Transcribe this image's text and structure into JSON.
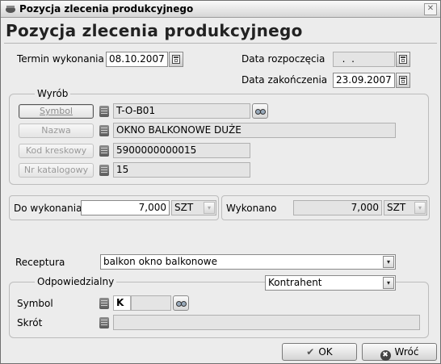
{
  "window": {
    "title": "Pozycja zlecenia produkcyjnego",
    "close_glyph": "✕"
  },
  "header": {
    "title": "Pozycja zlecenia produkcyjnego"
  },
  "dates": {
    "termin_label": "Termin wykonania",
    "termin_value": "08.10.2007",
    "rozpoczecie_label": "Data rozpoczęcia",
    "rozpoczecie_value": "  .  .",
    "zakonczenie_label": "Data zakończenia",
    "zakonczenie_value": "23.09.2007"
  },
  "wyrob": {
    "group_label": "Wyrób",
    "symbol_label": "Symbol",
    "symbol_value": "T-O-B01",
    "nazwa_label": "Nazwa",
    "nazwa_value": "OKNO BALKONOWE DUŻE",
    "kod_label": "Kod kreskowy",
    "kod_value": "5900000000015",
    "nr_label": "Nr katalogowy",
    "nr_value": "15"
  },
  "quantities": {
    "do_label": "Do wykonania",
    "do_value": "7,000",
    "do_unit": "SZT",
    "wyk_label": "Wykonano",
    "wyk_value": "7,000",
    "wyk_unit": "SZT"
  },
  "receptura": {
    "label": "Receptura",
    "value": "balkon okno balkonowe"
  },
  "odpowiedzialny": {
    "group_label": "Odpowiedzialny",
    "type_value": "Kontrahent",
    "symbol_label": "Symbol",
    "symbol_prefix": "K",
    "symbol_value": "",
    "skrot_label": "Skrót",
    "skrot_value": ""
  },
  "buttons": {
    "ok_label": "OK",
    "back_label": "Wróć",
    "ok_glyph": "✔",
    "back_glyph": "✖",
    "dropdown_glyph": "▾"
  },
  "icons": [
    "window-app-icon",
    "close-icon",
    "calendar-icon",
    "key-icon",
    "binoculars-icon",
    "check-icon",
    "cancel-icon",
    "chevron-down-icon"
  ]
}
